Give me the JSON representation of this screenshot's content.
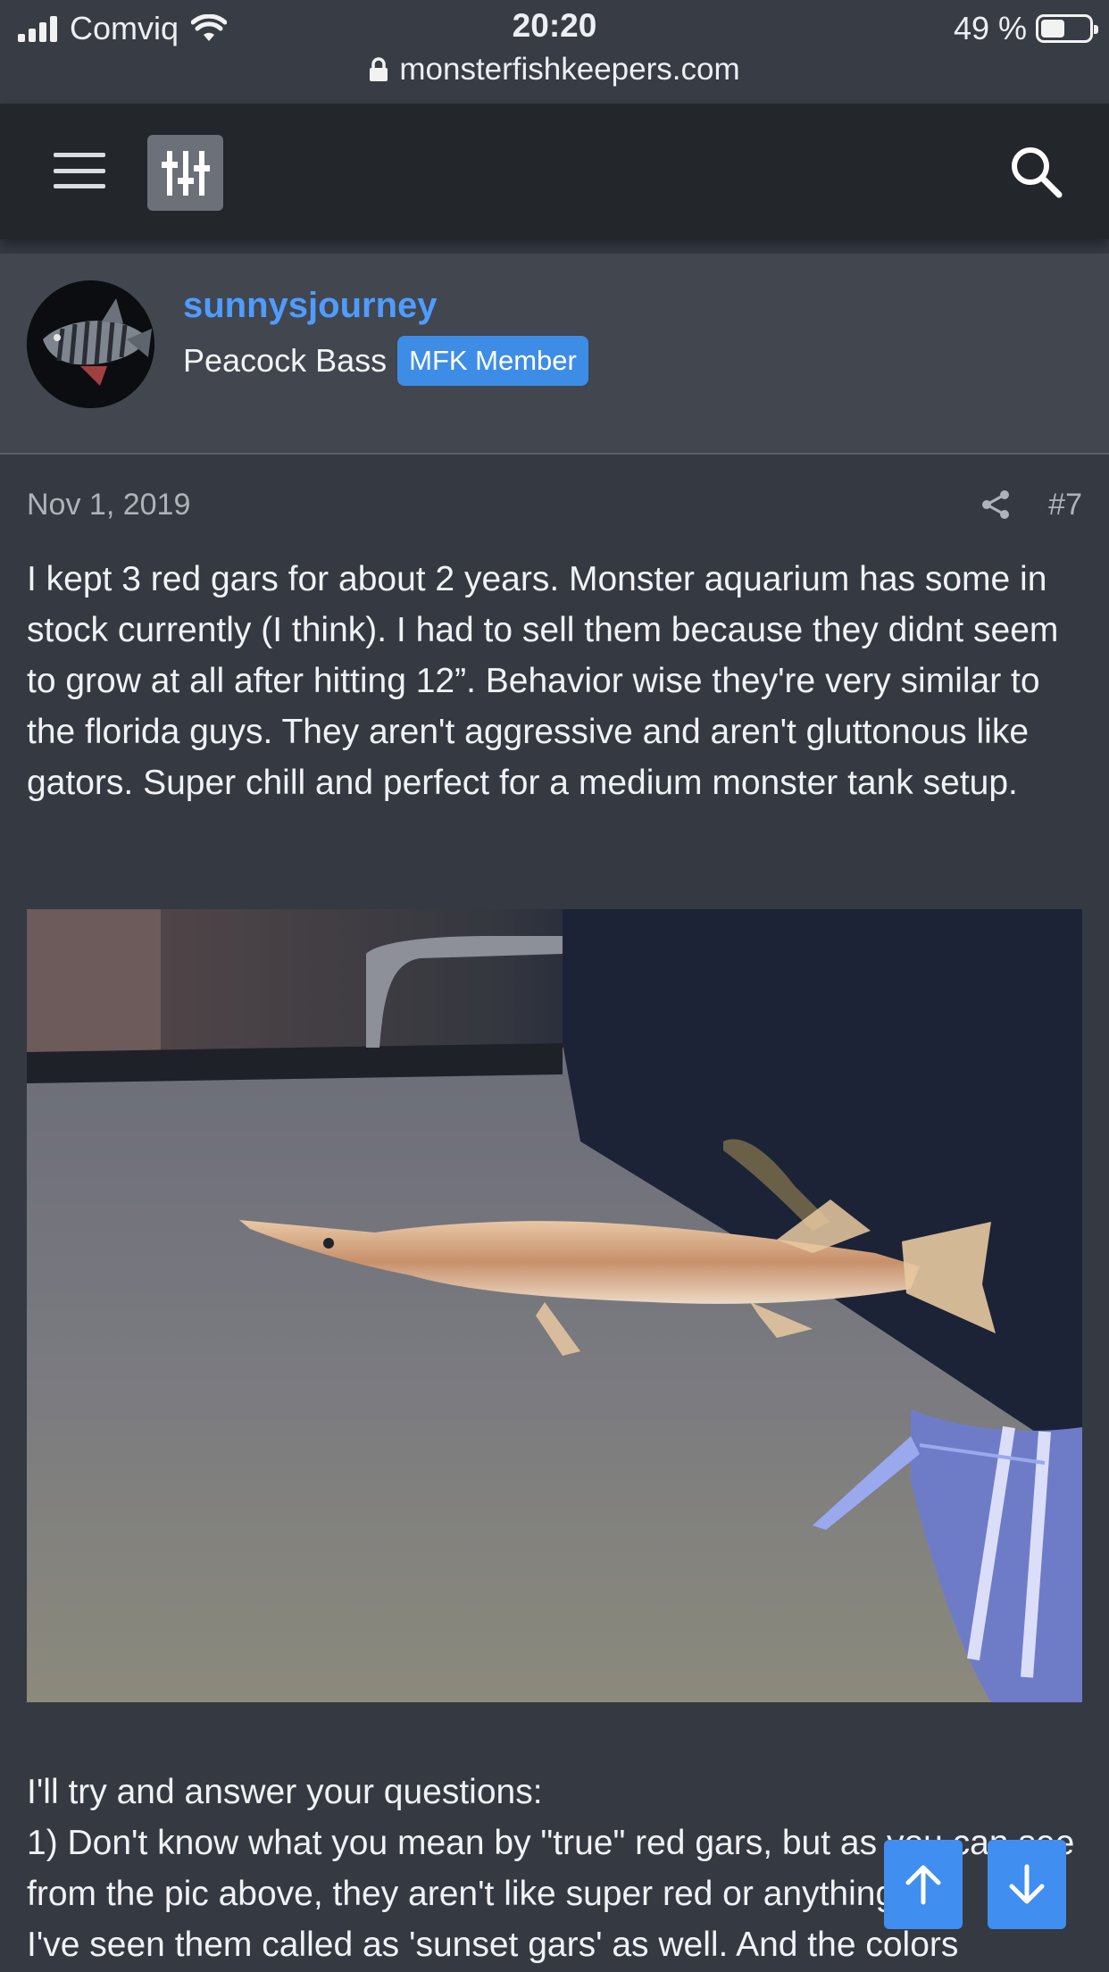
{
  "status_bar": {
    "carrier": "Comviq",
    "time": "20:20",
    "battery": "49 %",
    "battery_level": 0.49
  },
  "browser": {
    "url": "monsterfishkeepers.com"
  },
  "navbar": {
    "menu_icon": "hamburger-icon",
    "filter_icon": "sliders-icon",
    "search_icon": "search-icon"
  },
  "post": {
    "author": "sunnysjourney",
    "user_title": "Peacock Bass",
    "badge": "MFK Member",
    "date": "Nov 1, 2019",
    "post_number": "#7",
    "body_paragraph_1": "I kept 3 red gars for about 2 years. Monster aquarium has some in stock currently (I think). I had to sell them because they didnt seem to grow at all after hitting 12”. Behavior wise they're very similar to the florida guys. They aren't aggressive and aren't gluttonous like gators. Super chill and perfect for a medium monster tank setup.",
    "body_paragraph_2_line_1": "I'll try and answer your questions:",
    "body_paragraph_2_line_2": "1) Don't know what you mean by \"true\" red gars, but as you can see from the pic above, they aren't like super red or anything.",
    "body_paragraph_2_line_3": "I've seen them called as 'sunset gars' as well. And the colors"
  },
  "floating_buttons": {
    "up_icon": "arrow-up-icon",
    "down_icon": "arrow-down-icon"
  },
  "colors": {
    "link_blue": "#4f9cff",
    "badge_blue": "#3d8de6",
    "fab_blue": "#3f8ef0",
    "page_bg": "#353941",
    "header_bg": "#23262b"
  }
}
